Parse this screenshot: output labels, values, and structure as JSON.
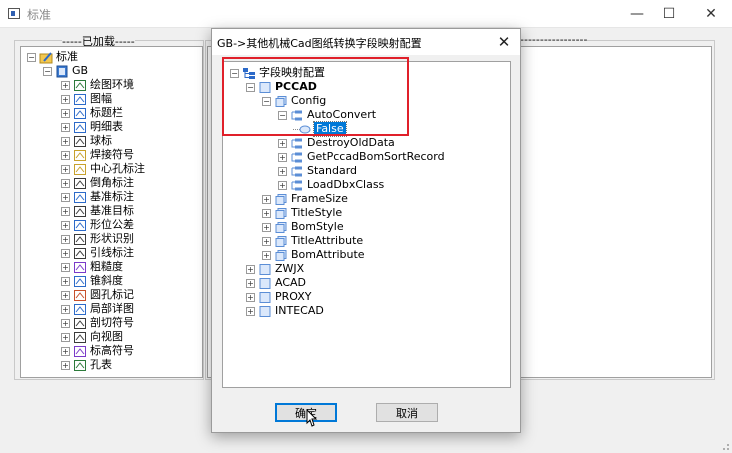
{
  "window": {
    "title": "标准"
  },
  "left_group": {
    "caption": "-----已加载-----"
  },
  "right_group": {
    "caption": "-----------------"
  },
  "left_tree": {
    "root": "标准",
    "gb": "GB",
    "items": [
      "绘图环境",
      "图幅",
      "标题栏",
      "明细表",
      "球标",
      "焊接符号",
      "中心孔标注",
      "倒角标注",
      "基准标注",
      "基准目标",
      "形位公差",
      "形状识别",
      "引线标注",
      "粗糙度",
      "锥斜度",
      "圆孔标记",
      "局部详图",
      "剖切符号",
      "向视图",
      "标高符号",
      "孔表"
    ]
  },
  "dialog": {
    "title": "GB->其他机械Cad图纸转换字段映射配置",
    "close": "✕",
    "ok": "确定",
    "cancel": "取消",
    "tree": {
      "root": "字段映射配置",
      "pccad": "PCCAD",
      "config": "Config",
      "autoconvert": "AutoConvert",
      "false_value": "False",
      "config_children": [
        "DestroyOldData",
        "GetPccadBomSortRecord",
        "Standard",
        "LoadDbxClass"
      ],
      "pccad_children": [
        "FrameSize",
        "TitleStyle",
        "BomStyle",
        "TitleAttribute",
        "BomAttribute"
      ],
      "others": [
        "ZWJX",
        "ACAD",
        "PROXY",
        "INTECAD"
      ]
    }
  },
  "colors": {
    "highlight": "#e0202a",
    "selection": "#0078d7",
    "default_button_border": "#0078d7"
  }
}
